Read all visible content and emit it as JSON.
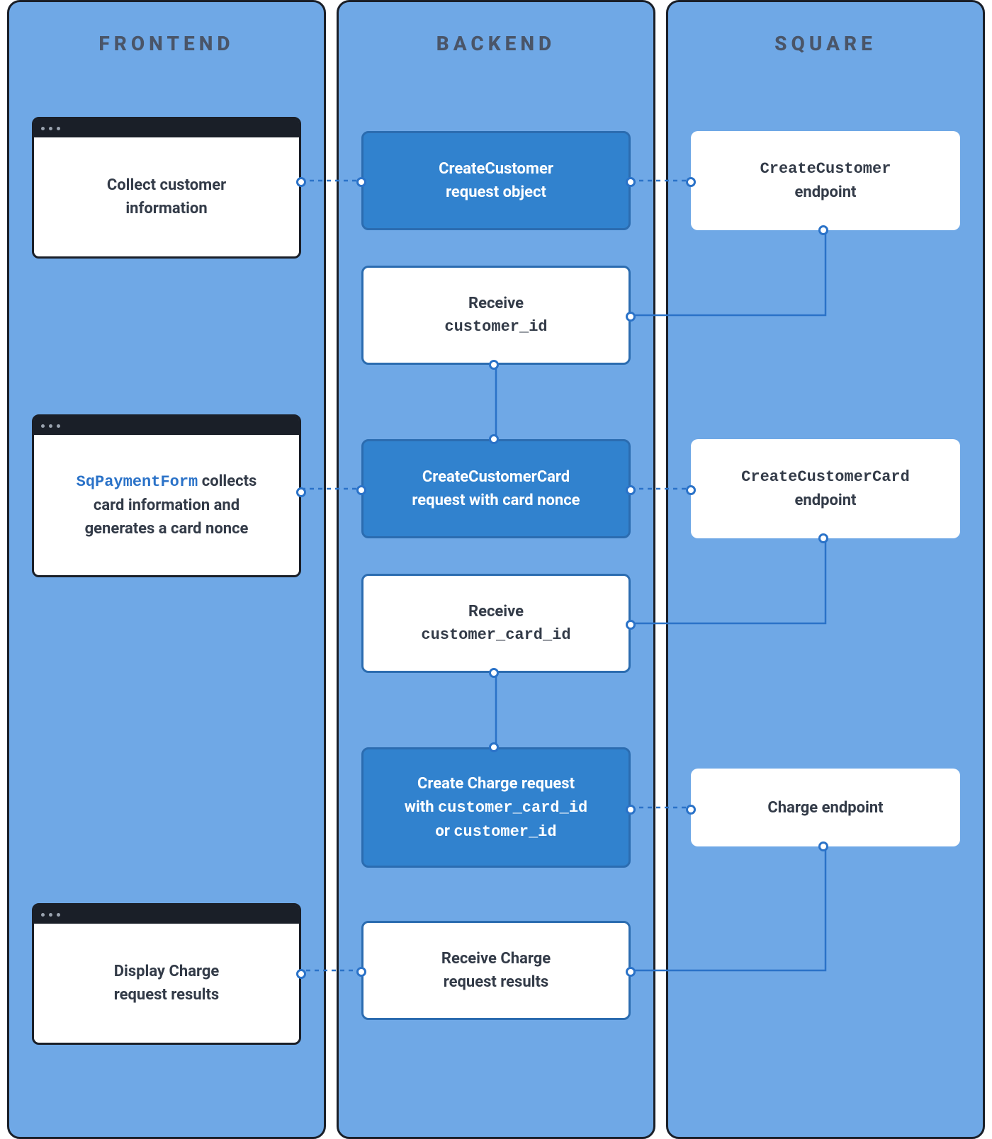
{
  "columns": {
    "frontend": "FRONTEND",
    "backend": "BACKEND",
    "square": "SQUARE"
  },
  "frontend": {
    "fe1": {
      "l1": "Collect customer",
      "l2": "information"
    },
    "fe2": {
      "code": "SqPaymentForm",
      "rest1": " collects",
      "l2": "card information and",
      "l3": "generates a card nonce"
    },
    "fe3": {
      "l1": "Display Charge",
      "l2": "request results"
    }
  },
  "backend": {
    "be1": {
      "l1": "CreateCustomer",
      "l2": "request object"
    },
    "be2": {
      "l1": "Receive",
      "code": "customer_id"
    },
    "be3": {
      "l1": "CreateCustomerCard",
      "l2": "request with card nonce"
    },
    "be4": {
      "l1": "Receive",
      "code": "customer_card_id"
    },
    "be5": {
      "l1": "Create Charge request",
      "pre2": "with ",
      "code2": "customer_card_id",
      "pre3": "or ",
      "code3": "customer_id"
    },
    "be6": {
      "l1": "Receive Charge",
      "l2": "request results"
    }
  },
  "square": {
    "sq1": {
      "code": "CreateCustomer",
      "l2": "endpoint"
    },
    "sq2": {
      "code": "CreateCustomerCard",
      "l2": "endpoint"
    },
    "sq3": {
      "l1": "Charge endpoint"
    }
  }
}
